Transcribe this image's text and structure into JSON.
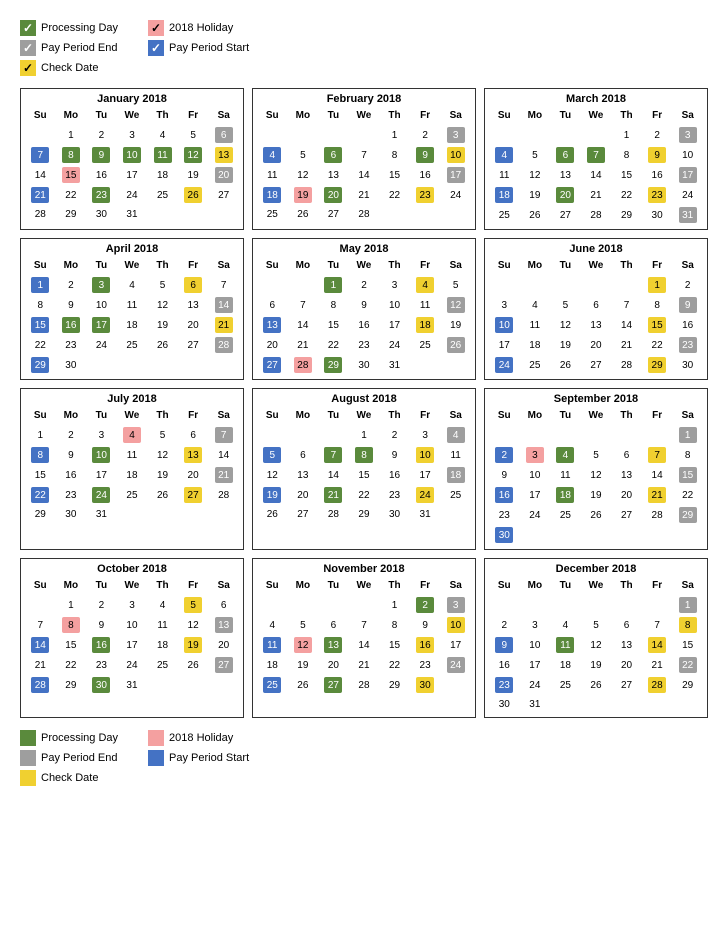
{
  "legend_top": {
    "items_left": [
      {
        "label": "Processing Day",
        "color": "green",
        "check": "✓"
      },
      {
        "label": "Pay Period End",
        "color": "gray",
        "check": "✓"
      },
      {
        "label": "Check Date",
        "color": "yellow",
        "check": "✓"
      }
    ],
    "items_right": [
      {
        "label": "2018 Holiday",
        "color": "pink",
        "check": "✓"
      },
      {
        "label": "Pay Period Start",
        "color": "blue",
        "check": "✓"
      }
    ]
  },
  "legend_bottom": {
    "items_left": [
      {
        "label": "Processing Day",
        "color": "green"
      },
      {
        "label": "Pay Period End",
        "color": "gray"
      },
      {
        "label": "Check Date",
        "color": "yellow"
      }
    ],
    "items_right": [
      {
        "label": "2018 Holiday",
        "color": "pink"
      },
      {
        "label": "Pay Period Start",
        "color": "blue"
      }
    ]
  },
  "months": [
    {
      "name": "January 2018",
      "days_header": [
        "Su",
        "Mo",
        "Tu",
        "We",
        "Th",
        "Fr",
        "Sa"
      ],
      "rows": [
        [
          null,
          1,
          2,
          3,
          4,
          5,
          {
            "n": 6,
            "c": "gray"
          }
        ],
        [
          {
            "n": 7,
            "c": "blue"
          },
          {
            "n": 8,
            "c": "green"
          },
          {
            "n": 9,
            "c": "green"
          },
          {
            "n": 10,
            "c": "green"
          },
          {
            "n": 11,
            "c": "green"
          },
          {
            "n": 12,
            "c": "green"
          },
          {
            "n": 13,
            "c": "yellow"
          }
        ],
        [
          14,
          {
            "n": 15,
            "c": "pink"
          },
          16,
          17,
          18,
          19,
          {
            "n": 20,
            "c": "gray"
          }
        ],
        [
          {
            "n": 21,
            "c": "blue"
          },
          22,
          {
            "n": 23,
            "c": "green"
          },
          24,
          25,
          {
            "n": 26,
            "c": "yellow"
          },
          27
        ],
        [
          28,
          29,
          30,
          31,
          null,
          null,
          null
        ]
      ]
    },
    {
      "name": "February 2018",
      "days_header": [
        "Su",
        "Mo",
        "Tu",
        "We",
        "Th",
        "Fr",
        "Sa"
      ],
      "rows": [
        [
          null,
          null,
          null,
          null,
          1,
          2,
          {
            "n": 3,
            "c": "gray"
          }
        ],
        [
          {
            "n": 4,
            "c": "blue"
          },
          5,
          {
            "n": 6,
            "c": "green"
          },
          7,
          8,
          {
            "n": 9,
            "c": "green"
          },
          {
            "n": 10,
            "c": "yellow"
          }
        ],
        [
          11,
          12,
          13,
          14,
          15,
          16,
          {
            "n": 17,
            "c": "gray"
          }
        ],
        [
          {
            "n": 18,
            "c": "blue"
          },
          {
            "n": 19,
            "c": "pink"
          },
          {
            "n": 20,
            "c": "green"
          },
          21,
          22,
          {
            "n": 23,
            "c": "yellow"
          },
          24
        ],
        [
          25,
          26,
          27,
          28,
          null,
          null,
          null
        ]
      ]
    },
    {
      "name": "March 2018",
      "days_header": [
        "Su",
        "Mo",
        "Tu",
        "We",
        "Th",
        "Fr",
        "Sa"
      ],
      "rows": [
        [
          null,
          null,
          null,
          null,
          1,
          2,
          {
            "n": 3,
            "c": "gray"
          }
        ],
        [
          {
            "n": 4,
            "c": "blue"
          },
          5,
          {
            "n": 6,
            "c": "green"
          },
          {
            "n": 7,
            "c": "green"
          },
          8,
          {
            "n": 9,
            "c": "yellow"
          },
          10
        ],
        [
          11,
          12,
          13,
          14,
          15,
          16,
          {
            "n": 17,
            "c": "gray"
          }
        ],
        [
          {
            "n": 18,
            "c": "blue"
          },
          19,
          {
            "n": 20,
            "c": "green"
          },
          21,
          22,
          {
            "n": 23,
            "c": "yellow"
          },
          24
        ],
        [
          25,
          26,
          27,
          28,
          29,
          30,
          {
            "n": 31,
            "c": "gray"
          }
        ]
      ]
    },
    {
      "name": "April 2018",
      "days_header": [
        "Su",
        "Mo",
        "Tu",
        "We",
        "Th",
        "Fr",
        "Sa"
      ],
      "rows": [
        [
          {
            "n": 1,
            "c": "blue"
          },
          2,
          {
            "n": 3,
            "c": "green"
          },
          4,
          5,
          {
            "n": 6,
            "c": "yellow"
          },
          7
        ],
        [
          8,
          9,
          10,
          11,
          12,
          13,
          {
            "n": 14,
            "c": "gray"
          }
        ],
        [
          {
            "n": 15,
            "c": "blue"
          },
          {
            "n": 16,
            "c": "green"
          },
          {
            "n": 17,
            "c": "green"
          },
          18,
          19,
          20,
          {
            "n": 21,
            "c": "yellow"
          }
        ],
        [
          22,
          23,
          24,
          25,
          26,
          27,
          {
            "n": 28,
            "c": "gray"
          }
        ],
        [
          {
            "n": 29,
            "c": "blue"
          },
          30,
          null,
          null,
          null,
          null,
          null
        ]
      ]
    },
    {
      "name": "May 2018",
      "days_header": [
        "Su",
        "Mo",
        "Tu",
        "We",
        "Th",
        "Fr",
        "Sa"
      ],
      "rows": [
        [
          null,
          null,
          {
            "n": 1,
            "c": "green"
          },
          2,
          3,
          {
            "n": 4,
            "c": "yellow"
          },
          5
        ],
        [
          6,
          7,
          8,
          9,
          10,
          11,
          {
            "n": 12,
            "c": "gray"
          }
        ],
        [
          {
            "n": 13,
            "c": "blue"
          },
          14,
          15,
          16,
          17,
          {
            "n": 18,
            "c": "yellow"
          },
          19
        ],
        [
          20,
          21,
          22,
          23,
          24,
          25,
          {
            "n": 26,
            "c": "gray"
          }
        ],
        [
          {
            "n": 27,
            "c": "blue"
          },
          {
            "n": 28,
            "c": "pink"
          },
          {
            "n": 29,
            "c": "green"
          },
          30,
          31,
          null,
          null
        ]
      ]
    },
    {
      "name": "June 2018",
      "days_header": [
        "Su",
        "Mo",
        "Tu",
        "We",
        "Th",
        "Fr",
        "Sa"
      ],
      "rows": [
        [
          null,
          null,
          null,
          null,
          null,
          {
            "n": 1,
            "c": "yellow"
          },
          2
        ],
        [
          3,
          4,
          5,
          6,
          7,
          8,
          {
            "n": 9,
            "c": "gray"
          }
        ],
        [
          {
            "n": 10,
            "c": "blue"
          },
          11,
          12,
          13,
          14,
          {
            "n": 15,
            "c": "yellow"
          },
          16
        ],
        [
          17,
          18,
          19,
          20,
          21,
          22,
          {
            "n": 23,
            "c": "gray"
          }
        ],
        [
          {
            "n": 24,
            "c": "blue"
          },
          25,
          26,
          27,
          28,
          {
            "n": 29,
            "c": "yellow"
          },
          30
        ]
      ]
    },
    {
      "name": "July 2018",
      "days_header": [
        "Su",
        "Mo",
        "Tu",
        "We",
        "Th",
        "Fr",
        "Sa"
      ],
      "rows": [
        [
          1,
          2,
          3,
          {
            "n": 4,
            "c": "pink"
          },
          5,
          6,
          {
            "n": 7,
            "c": "gray"
          }
        ],
        [
          {
            "n": 8,
            "c": "blue"
          },
          9,
          {
            "n": 10,
            "c": "green"
          },
          11,
          12,
          {
            "n": 13,
            "c": "yellow"
          },
          14
        ],
        [
          15,
          16,
          17,
          18,
          19,
          20,
          {
            "n": 21,
            "c": "gray"
          }
        ],
        [
          {
            "n": 22,
            "c": "blue"
          },
          23,
          {
            "n": 24,
            "c": "green"
          },
          25,
          26,
          {
            "n": 27,
            "c": "yellow"
          },
          28
        ],
        [
          29,
          30,
          31,
          null,
          null,
          null,
          null
        ]
      ]
    },
    {
      "name": "August 2018",
      "days_header": [
        "Su",
        "Mo",
        "Tu",
        "We",
        "Th",
        "Fr",
        "Sa"
      ],
      "rows": [
        [
          null,
          null,
          null,
          1,
          2,
          3,
          {
            "n": 4,
            "c": "gray"
          }
        ],
        [
          {
            "n": 5,
            "c": "blue"
          },
          6,
          {
            "n": 7,
            "c": "green"
          },
          {
            "n": 8,
            "c": "green"
          },
          9,
          {
            "n": 10,
            "c": "yellow"
          },
          11
        ],
        [
          12,
          13,
          14,
          15,
          16,
          17,
          {
            "n": 18,
            "c": "gray"
          }
        ],
        [
          {
            "n": 19,
            "c": "blue"
          },
          20,
          {
            "n": 21,
            "c": "green"
          },
          22,
          23,
          {
            "n": 24,
            "c": "yellow"
          },
          25
        ],
        [
          26,
          27,
          28,
          29,
          30,
          31,
          null
        ]
      ]
    },
    {
      "name": "September 2018",
      "days_header": [
        "Su",
        "Mo",
        "Tu",
        "We",
        "Th",
        "Fr",
        "Sa"
      ],
      "rows": [
        [
          null,
          null,
          null,
          null,
          null,
          null,
          {
            "n": 1,
            "c": "gray"
          }
        ],
        [
          {
            "n": 2,
            "c": "blue"
          },
          {
            "n": 3,
            "c": "pink"
          },
          {
            "n": 4,
            "c": "green"
          },
          5,
          6,
          {
            "n": 7,
            "c": "yellow"
          },
          8
        ],
        [
          9,
          10,
          11,
          12,
          13,
          14,
          {
            "n": 15,
            "c": "gray"
          }
        ],
        [
          {
            "n": 16,
            "c": "blue"
          },
          17,
          {
            "n": 18,
            "c": "green"
          },
          19,
          20,
          {
            "n": 21,
            "c": "yellow"
          },
          22
        ],
        [
          23,
          24,
          25,
          26,
          27,
          28,
          {
            "n": 29,
            "c": "gray"
          }
        ],
        [
          {
            "n": 30,
            "c": "blue"
          },
          null,
          null,
          null,
          null,
          null,
          null
        ]
      ]
    },
    {
      "name": "October 2018",
      "days_header": [
        "Su",
        "Mo",
        "Tu",
        "We",
        "Th",
        "Fr",
        "Sa"
      ],
      "rows": [
        [
          null,
          1,
          2,
          3,
          4,
          {
            "n": 5,
            "c": "yellow"
          },
          6
        ],
        [
          7,
          {
            "n": 8,
            "c": "pink"
          },
          9,
          10,
          11,
          12,
          {
            "n": 13,
            "c": "gray"
          }
        ],
        [
          {
            "n": 14,
            "c": "blue"
          },
          15,
          {
            "n": 16,
            "c": "green"
          },
          17,
          18,
          {
            "n": 19,
            "c": "yellow"
          },
          20
        ],
        [
          21,
          22,
          23,
          24,
          25,
          26,
          {
            "n": 27,
            "c": "gray"
          }
        ],
        [
          {
            "n": 28,
            "c": "blue"
          },
          29,
          {
            "n": 30,
            "c": "green"
          },
          31,
          null,
          null,
          null
        ]
      ]
    },
    {
      "name": "November 2018",
      "days_header": [
        "Su",
        "Mo",
        "Tu",
        "We",
        "Th",
        "Fr",
        "Sa"
      ],
      "rows": [
        [
          null,
          null,
          null,
          null,
          1,
          {
            "n": 2,
            "c": "green"
          },
          {
            "n": 3,
            "c": "gray"
          }
        ],
        [
          4,
          5,
          6,
          7,
          8,
          9,
          {
            "n": 10,
            "c": "yellow"
          }
        ],
        [
          {
            "n": 11,
            "c": "blue"
          },
          {
            "n": 12,
            "c": "pink"
          },
          {
            "n": 13,
            "c": "green"
          },
          14,
          15,
          {
            "n": 16,
            "c": "yellow"
          },
          17
        ],
        [
          18,
          19,
          20,
          21,
          22,
          23,
          {
            "n": 24,
            "c": "gray"
          }
        ],
        [
          {
            "n": 25,
            "c": "blue"
          },
          26,
          {
            "n": 27,
            "c": "green"
          },
          28,
          29,
          {
            "n": 30,
            "c": "yellow"
          },
          null
        ]
      ]
    },
    {
      "name": "December 2018",
      "days_header": [
        "Su",
        "Mo",
        "Tu",
        "We",
        "Th",
        "Fr",
        "Sa"
      ],
      "rows": [
        [
          null,
          null,
          null,
          null,
          null,
          null,
          {
            "n": 1,
            "c": "gray"
          }
        ],
        [
          2,
          3,
          4,
          5,
          6,
          7,
          {
            "n": 8,
            "c": "yellow"
          }
        ],
        [
          {
            "n": 9,
            "c": "blue"
          },
          10,
          {
            "n": 11,
            "c": "green"
          },
          12,
          13,
          {
            "n": 14,
            "c": "yellow"
          },
          15
        ],
        [
          16,
          17,
          18,
          19,
          20,
          21,
          {
            "n": 22,
            "c": "gray"
          }
        ],
        [
          {
            "n": 23,
            "c": "blue"
          },
          24,
          25,
          26,
          27,
          {
            "n": 28,
            "c": "yellow"
          },
          29
        ],
        [
          30,
          31,
          null,
          null,
          null,
          null,
          null
        ]
      ]
    }
  ]
}
